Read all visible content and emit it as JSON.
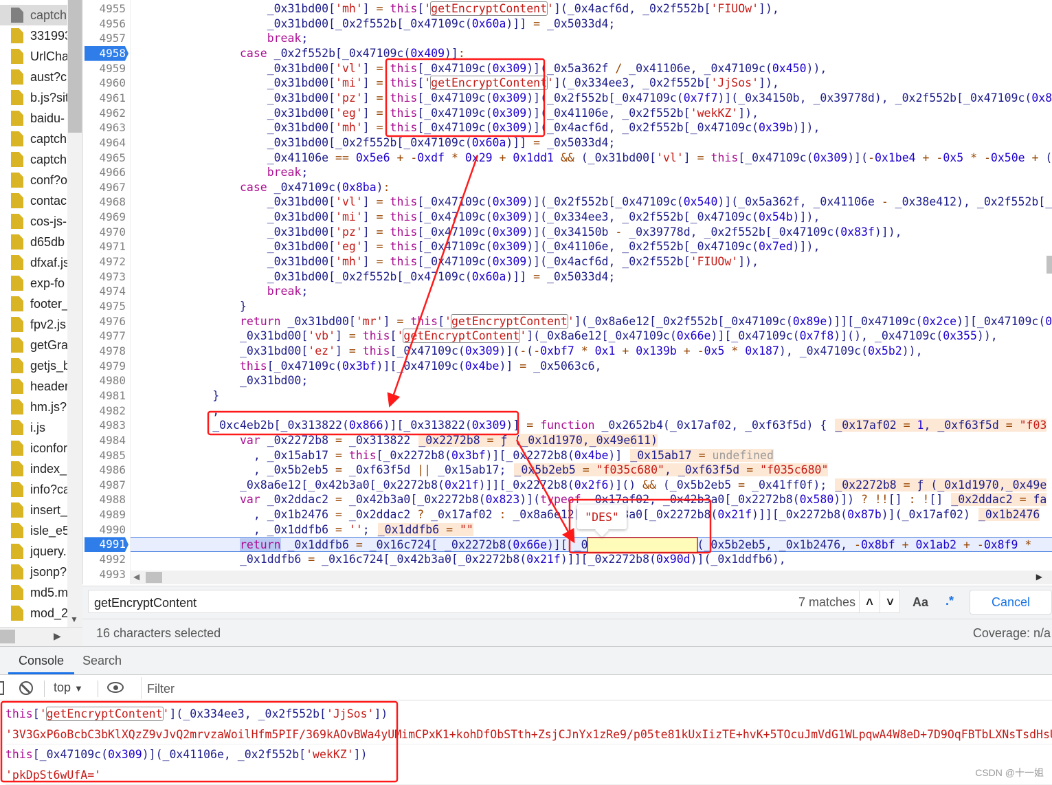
{
  "sidebar": {
    "files": [
      "captch",
      "331993",
      "UrlCha",
      "aust?cl",
      "b.js?sit",
      "baidu-",
      "captch",
      "captch",
      "conf?o",
      "contac",
      "cos-js-",
      "d65db",
      "dfxaf.js",
      "exp-fo",
      "footer_",
      "fpv2.js",
      "getGra",
      "getjs_b",
      "header",
      "hm.js?",
      "i.js",
      "iconfor",
      "index_",
      "info?ca",
      "insert_",
      "isle_e5",
      "jquery.",
      "jsonp?",
      "md5.m",
      "mod_2"
    ],
    "selected_index": 0
  },
  "editor": {
    "breakpoint_lines": [
      4958,
      4991
    ],
    "current_line": 4991,
    "lines": [
      {
        "n": 4955,
        "i": 20,
        "code": "_0x31bd00['mh'] = this['getEncryptContent'](_0x4acf6d, _0x2f552b['FIUOw']),"
      },
      {
        "n": 4956,
        "i": 20,
        "code": "_0x31bd00[_0x2f552b[_0x47109c(0x60a)]] = _0x5033d4;"
      },
      {
        "n": 4957,
        "i": 20,
        "code": "break;"
      },
      {
        "n": 4958,
        "i": 16,
        "code": "case _0x2f552b[_0x47109c(0x409)]:"
      },
      {
        "n": 4959,
        "i": 20,
        "code": "_0x31bd00['vl'] = this[_0x47109c(0x309)](_0x5a362f / _0x41106e, _0x47109c(0x450)),"
      },
      {
        "n": 4960,
        "i": 20,
        "code": "_0x31bd00['mi'] = this['getEncryptContent'](_0x334ee3, _0x2f552b['JjSos']),"
      },
      {
        "n": 4961,
        "i": 20,
        "code": "_0x31bd00['pz'] = this[_0x47109c(0x309)](_0x2f552b[_0x47109c(0x7f7)](_0x34150b, _0x39778d), _0x2f552b[_0x47109c(0x8"
      },
      {
        "n": 4962,
        "i": 20,
        "code": "_0x31bd00['eg'] = this[_0x47109c(0x309)](_0x41106e, _0x2f552b['wekKZ']),"
      },
      {
        "n": 4963,
        "i": 20,
        "code": "_0x31bd00['mh'] = this[_0x47109c(0x309)](_0x4acf6d, _0x2f552b[_0x47109c(0x39b)]),"
      },
      {
        "n": 4964,
        "i": 20,
        "code": "_0x31bd00[_0x2f552b[_0x47109c(0x60a)]] = _0x5033d4;"
      },
      {
        "n": 4965,
        "i": 20,
        "code": "_0x41106e == 0x5e6 + -0xdf * 0x29 + 0x1dd1 && (_0x31bd00['vl'] = this[_0x47109c(0x309)](-0x1be4 + -0x5 * -0x50e + ("
      },
      {
        "n": 4966,
        "i": 20,
        "code": "break;"
      },
      {
        "n": 4967,
        "i": 16,
        "code": "case _0x47109c(0x8ba):"
      },
      {
        "n": 4968,
        "i": 20,
        "code": "_0x31bd00['vl'] = this[_0x47109c(0x309)](_0x2f552b[_0x47109c(0x540)](_0x5a362f, _0x41106e - _0x38e412), _0x2f552b[_"
      },
      {
        "n": 4969,
        "i": 20,
        "code": "_0x31bd00['mi'] = this[_0x47109c(0x309)](_0x334ee3, _0x2f552b[_0x47109c(0x54b)]),"
      },
      {
        "n": 4970,
        "i": 20,
        "code": "_0x31bd00['pz'] = this[_0x47109c(0x309)](_0x34150b - _0x39778d, _0x2f552b[_0x47109c(0x83f)]),"
      },
      {
        "n": 4971,
        "i": 20,
        "code": "_0x31bd00['eg'] = this[_0x47109c(0x309)](_0x41106e, _0x2f552b[_0x47109c(0x7ed)]),"
      },
      {
        "n": 4972,
        "i": 20,
        "code": "_0x31bd00['mh'] = this[_0x47109c(0x309)](_0x4acf6d, _0x2f552b['FIUOw']),"
      },
      {
        "n": 4973,
        "i": 20,
        "code": "_0x31bd00[_0x2f552b[_0x47109c(0x60a)]] = _0x5033d4;"
      },
      {
        "n": 4974,
        "i": 20,
        "code": "break;"
      },
      {
        "n": 4975,
        "i": 16,
        "code": "}"
      },
      {
        "n": 4976,
        "i": 16,
        "code": "return _0x31bd00['mr'] = this['getEncryptContent'](_0x8a6e12[_0x2f552b[_0x47109c(0x89e)]][_0x47109c(0x2ce)][_0x47109c(0"
      },
      {
        "n": 4977,
        "i": 16,
        "code": "_0x31bd00['vb'] = this['getEncryptContent'](_0x8a6e12[_0x47109c(0x66e)][_0x47109c(0x7f8)](), _0x47109c(0x355)),"
      },
      {
        "n": 4978,
        "i": 16,
        "code": "_0x31bd00['ez'] = this[_0x47109c(0x309)](-(-0xbf7 * 0x1 + 0x139b + -0x5 * 0x187), _0x47109c(0x5b2)),"
      },
      {
        "n": 4979,
        "i": 16,
        "code": "this[_0x47109c(0x3bf)][_0x47109c(0x4be)] = _0x5063c6,"
      },
      {
        "n": 4980,
        "i": 16,
        "code": "_0x31bd00;"
      },
      {
        "n": 4981,
        "i": 12,
        "code": "}"
      },
      {
        "n": 4982,
        "i": 12,
        "code": ","
      },
      {
        "n": 4983,
        "i": 12,
        "code": "_0xc4eb2b[_0x313822(0x866)][_0x313822(0x309)] = function _0x2652b4(_0x17af02, _0xf63f5d) {",
        "inline": "_0x17af02 = 1, _0xf63f5d = \"f03"
      },
      {
        "n": 4984,
        "i": 16,
        "code": "var _0x2272b8 = _0x313822",
        "inline": "_0x2272b8 = ƒ (_0x1d1970,_0x49e611)"
      },
      {
        "n": 4985,
        "i": 18,
        "code": ", _0x15ab17 = this[_0x2272b8(0x3bf)][_0x2272b8(0x4be)]",
        "inline": "_0x15ab17 = undefined"
      },
      {
        "n": 4986,
        "i": 18,
        "code": ", _0x5b2eb5 = _0xf63f5d || _0x15ab17;",
        "inline": "_0x5b2eb5 = \"f035c680\", _0xf63f5d = \"f035c680\""
      },
      {
        "n": 4987,
        "i": 16,
        "code": "_0x8a6e12[_0x42b3a0[_0x2272b8(0x21f)]][_0x2272b8(0x2f6)]() && (_0x5b2eb5 = _0x41ff0f);",
        "inline": "_0x2272b8 = ƒ (_0x1d1970,_0x49e"
      },
      {
        "n": 4988,
        "i": 16,
        "code": "var _0x2ddac2 = _0x42b3a0[_0x2272b8(0x823)](typeof _0x17af02, _0x42b3a0[_0x2272b8(0x580)]) ? !![] : ![]",
        "inline": "_0x2ddac2 = fa"
      },
      {
        "n": 4989,
        "i": 18,
        "code": ", _0x1b2476 = _0x2ddac2 ? _0x17af02 : _0x8a6e12[_0x42b3a0[_0x2272b8(0x21f)]][_0x2272b8(0x87b)](_0x17af02)",
        "inline": "_0x1b2476"
      },
      {
        "n": 4990,
        "i": 18,
        "code": ", _0x1ddfb6 = '';",
        "inline": "_0x1ddfb6 = \"\""
      },
      {
        "n": 4991,
        "i": 16,
        "code": "return _0x1ddfb6 = _0x16c724[ _0x2272b8(0x66e)][ _0x2272b8(0x88e)] (_0x5b2eb5, _0x1b2476, -0x8bf + 0x1ab2 + -0x8f9 *"
      },
      {
        "n": 4992,
        "i": 16,
        "code": "_0x1ddfb6 = _0x16c724[_0x42b3a0[_0x2272b8(0x21f)]][_0x2272b8(0x90d)](_0x1ddfb6),"
      },
      {
        "n": 4993,
        "i": 0,
        "code": ""
      }
    ],
    "tooltip_value": "\"DES\""
  },
  "search": {
    "query": "getEncryptContent",
    "matches": "7 matches",
    "prev_icon": "chevron-up-icon",
    "next_icon": "chevron-down-icon",
    "match_case": "Aa",
    "regex": ".*",
    "cancel": "Cancel"
  },
  "status": {
    "selection": "16 characters selected",
    "coverage": "Coverage: n/a"
  },
  "drawer": {
    "tabs": [
      "Console",
      "Search"
    ],
    "active_tab": "Console",
    "context": "top",
    "filter_placeholder": "Filter"
  },
  "console": [
    {
      "type": "input",
      "text": "this['getEncryptContent'](_0x334ee3, _0x2f552b['JjSos'])"
    },
    {
      "type": "result",
      "text": "'3V3GxP6oBcbC3bKlXQzZ9vJvQ2mrvzaWoilHfm5PIF/369kAOvBWa4yUMimCPxK1+kohDfObSTth+ZsjCJnYx1zRe9/p05te81kUxIizTE+hvK+5TOcuJmVdG1WLpqwA4W8eD+7D9OqFBTbLXNsTsdHsU"
    },
    {
      "type": "input",
      "text": "this[_0x47109c(0x309)](_0x41106e, _0x2f552b['wekKZ'])"
    },
    {
      "type": "result",
      "text": "'pkDpSt6wUfA='"
    }
  ],
  "watermark": "CSDN @十一姐",
  "colors": {
    "accent": "#1a73e8",
    "annotation": "#ff0000",
    "keyword": "#aa0d91",
    "string": "#c41a16",
    "number": "#1c00cf",
    "file_icon": "#d9b526"
  }
}
